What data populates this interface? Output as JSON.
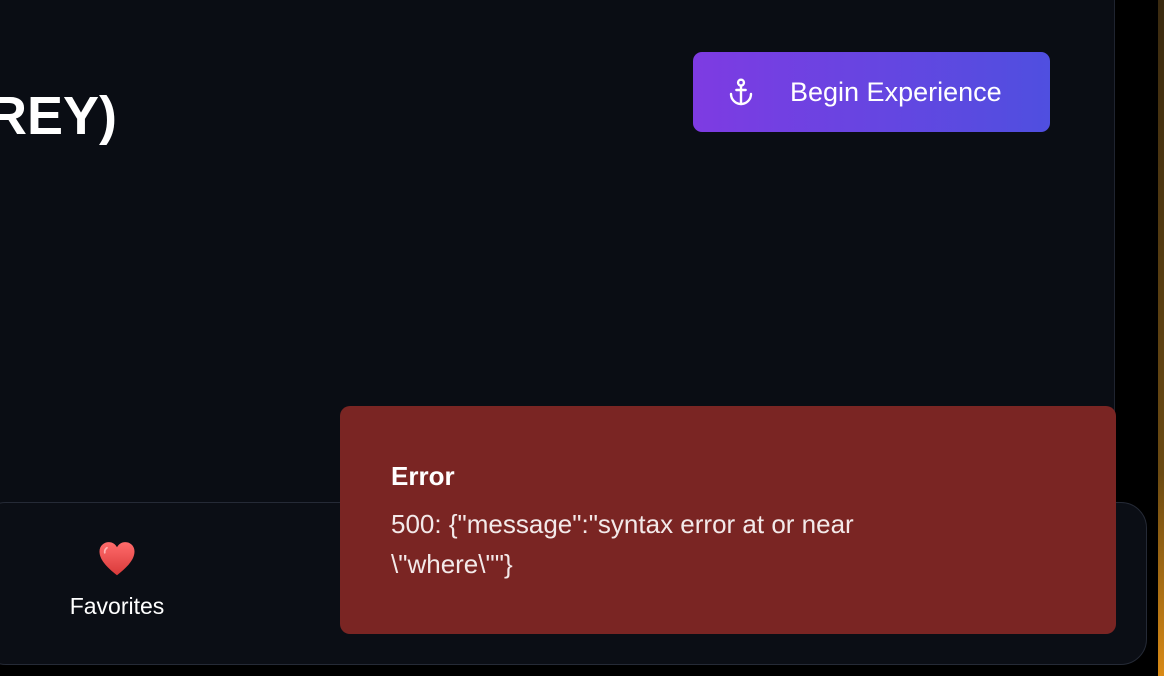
{
  "hero": {
    "title_visible": "REY)"
  },
  "actions": {
    "begin_label": "Begin Experience",
    "begin_icon": "anchor-icon"
  },
  "bottom_nav": {
    "items": [
      {
        "label": "Favorites",
        "icon": "heart-icon"
      }
    ]
  },
  "toast": {
    "title": "Error",
    "message": "500: {\"message\":\"syntax error at or near \\\"where\\\"\"}"
  },
  "colors": {
    "background": "#0a0d14",
    "button_gradient_start": "#7e3be2",
    "button_gradient_end": "#4f4fe0",
    "error_background": "#7a2523",
    "heart": "#e84a4a"
  }
}
